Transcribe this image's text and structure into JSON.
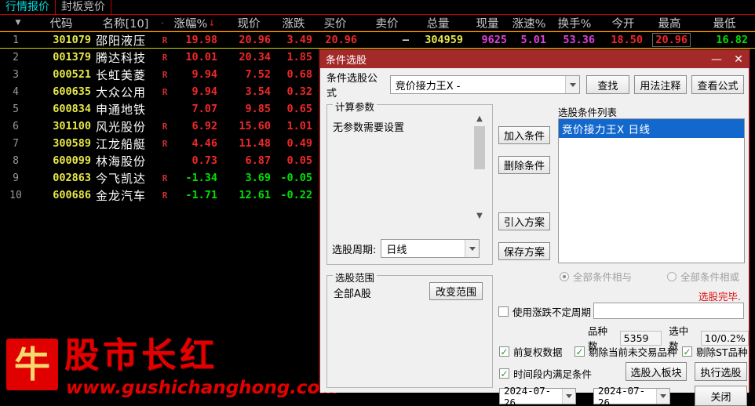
{
  "tabs": [
    {
      "label": "行情报价",
      "active": true
    },
    {
      "label": "封板竞价",
      "active": false
    }
  ],
  "table": {
    "columns": [
      {
        "key": "idx",
        "label": ""
      },
      {
        "key": "code",
        "label": "代码"
      },
      {
        "key": "name",
        "label": "名称[10]"
      },
      {
        "key": "dot",
        "label": "·"
      },
      {
        "key": "chgpct",
        "label": "涨幅%"
      },
      {
        "key": "price",
        "label": "现价"
      },
      {
        "key": "chg",
        "label": "涨跌"
      },
      {
        "key": "bid",
        "label": "买价"
      },
      {
        "key": "ask",
        "label": "卖价"
      },
      {
        "key": "volume",
        "label": "总量"
      },
      {
        "key": "curvol",
        "label": "现量"
      },
      {
        "key": "speed",
        "label": "涨速%"
      },
      {
        "key": "turn",
        "label": "换手%"
      },
      {
        "key": "open",
        "label": "今开"
      },
      {
        "key": "high",
        "label": "最高"
      },
      {
        "key": "low",
        "label": "最低"
      }
    ],
    "sort_column": "涨幅%",
    "sort_dir": "desc",
    "rows": [
      {
        "idx": "1",
        "code": "301079",
        "name": "邵阳液压",
        "r": "R",
        "chgpct": "19.98",
        "price": "20.96",
        "chg": "3.49",
        "bid": "20.96",
        "ask": "–",
        "volume": "304959",
        "curvol": "9625",
        "speed": "5.01",
        "turn": "53.36",
        "open": "18.50",
        "high": "20.96",
        "low": "16.82",
        "dir": "up",
        "selected": true
      },
      {
        "idx": "2",
        "code": "001379",
        "name": "腾达科技",
        "r": "R",
        "chgpct": "10.01",
        "price": "20.34",
        "chg": "1.85",
        "bid": "",
        "ask": "",
        "volume": "",
        "curvol": "",
        "speed": "",
        "turn": "",
        "open": "",
        "high": "",
        "low": "",
        "dir": "up",
        "selected": false
      },
      {
        "idx": "3",
        "code": "000521",
        "name": "长虹美菱",
        "r": "R",
        "chgpct": "9.94",
        "price": "7.52",
        "chg": "0.68",
        "bid": "",
        "ask": "",
        "volume": "",
        "curvol": "",
        "speed": "",
        "turn": "",
        "open": "",
        "high": "",
        "low": "",
        "dir": "up",
        "selected": false
      },
      {
        "idx": "4",
        "code": "600635",
        "name": "大众公用",
        "r": "R",
        "chgpct": "9.94",
        "price": "3.54",
        "chg": "0.32",
        "bid": "",
        "ask": "",
        "volume": "",
        "curvol": "",
        "speed": "",
        "turn": "",
        "open": "",
        "high": "",
        "low": "",
        "dir": "up",
        "selected": false
      },
      {
        "idx": "5",
        "code": "600834",
        "name": "申通地铁",
        "r": "",
        "chgpct": "7.07",
        "price": "9.85",
        "chg": "0.65",
        "bid": "",
        "ask": "",
        "volume": "",
        "curvol": "",
        "speed": "",
        "turn": "",
        "open": "",
        "high": "",
        "low": "",
        "dir": "up",
        "selected": false
      },
      {
        "idx": "6",
        "code": "301100",
        "name": "风光股份",
        "r": "R",
        "chgpct": "6.92",
        "price": "15.60",
        "chg": "1.01",
        "bid": "",
        "ask": "",
        "volume": "",
        "curvol": "",
        "speed": "",
        "turn": "",
        "open": "",
        "high": "",
        "low": "",
        "dir": "up",
        "selected": false
      },
      {
        "idx": "7",
        "code": "300589",
        "name": "江龙船艇",
        "r": "R",
        "chgpct": "4.46",
        "price": "11.48",
        "chg": "0.49",
        "bid": "",
        "ask": "",
        "volume": "",
        "curvol": "",
        "speed": "",
        "turn": "",
        "open": "",
        "high": "",
        "low": "",
        "dir": "up",
        "selected": false
      },
      {
        "idx": "8",
        "code": "600099",
        "name": "林海股份",
        "r": "",
        "chgpct": "0.73",
        "price": "6.87",
        "chg": "0.05",
        "bid": "",
        "ask": "",
        "volume": "",
        "curvol": "",
        "speed": "",
        "turn": "",
        "open": "",
        "high": "",
        "low": "",
        "dir": "up",
        "selected": false
      },
      {
        "idx": "9",
        "code": "002863",
        "name": "今飞凯达",
        "r": "R",
        "chgpct": "-1.34",
        "price": "3.69",
        "chg": "-0.05",
        "bid": "",
        "ask": "",
        "volume": "",
        "curvol": "",
        "speed": "",
        "turn": "",
        "open": "",
        "high": "",
        "low": "",
        "dir": "down",
        "selected": false
      },
      {
        "idx": "10",
        "code": "600686",
        "name": "金龙汽车",
        "r": "R",
        "chgpct": "-1.71",
        "price": "12.61",
        "chg": "-0.22",
        "bid": "",
        "ask": "",
        "volume": "",
        "curvol": "",
        "speed": "",
        "turn": "",
        "open": "",
        "high": "",
        "low": "",
        "dir": "down",
        "selected": false
      }
    ]
  },
  "watermark": {
    "seal": "牛",
    "brand": "股市长红",
    "url": "www.gushichanghong.com"
  },
  "dialog": {
    "title": "条件选股",
    "minimize": "—",
    "close": "✕",
    "formula_label": "条件选股公式",
    "formula_value": "竞价接力王X  -",
    "find_button": "查找",
    "usage_button": "用法注释",
    "view_formula_button": "查看公式",
    "calc_group_label": "计算参数",
    "calc_text": "无参数需要设置",
    "period_label": "选股周期:",
    "period_value": "日线",
    "range_group_label": "选股范围",
    "range_value": "全部A股",
    "change_range_button": "改变范围",
    "add_condition_button": "加入条件",
    "del_condition_button": "删除条件",
    "import_plan_button": "引入方案",
    "save_plan_button": "保存方案",
    "condition_list_label": "选股条件列表",
    "condition_items": [
      "竞价接力王X  日线"
    ],
    "radio_and": "全部条件相与",
    "radio_or": "全部条件相或",
    "radio_selected": "and",
    "status_text": "选股完毕.",
    "uncertain_period_label": "使用涨跌不定周期",
    "uncertain_period_checked": false,
    "uncertain_period_value": "",
    "count_label": "品种数",
    "count_value": "5359",
    "selected_label": "选中数",
    "selected_value": "10/0.2%",
    "cb_forward_adj": "前复权数据",
    "cb_forward_adj_checked": true,
    "cb_exclude_untraded": "剔除当前未交易品种",
    "cb_exclude_untraded_checked": true,
    "cb_exclude_st": "剔除ST品种",
    "cb_exclude_st_checked": true,
    "cb_period_match": "时间段内满足条件",
    "cb_period_match_checked": true,
    "date_from": "2024-07-26",
    "date_sep": "-",
    "date_to": "2024-07-26",
    "select_to_block_button": "选股入板块",
    "execute_button": "执行选股",
    "close_button": "关闭"
  }
}
